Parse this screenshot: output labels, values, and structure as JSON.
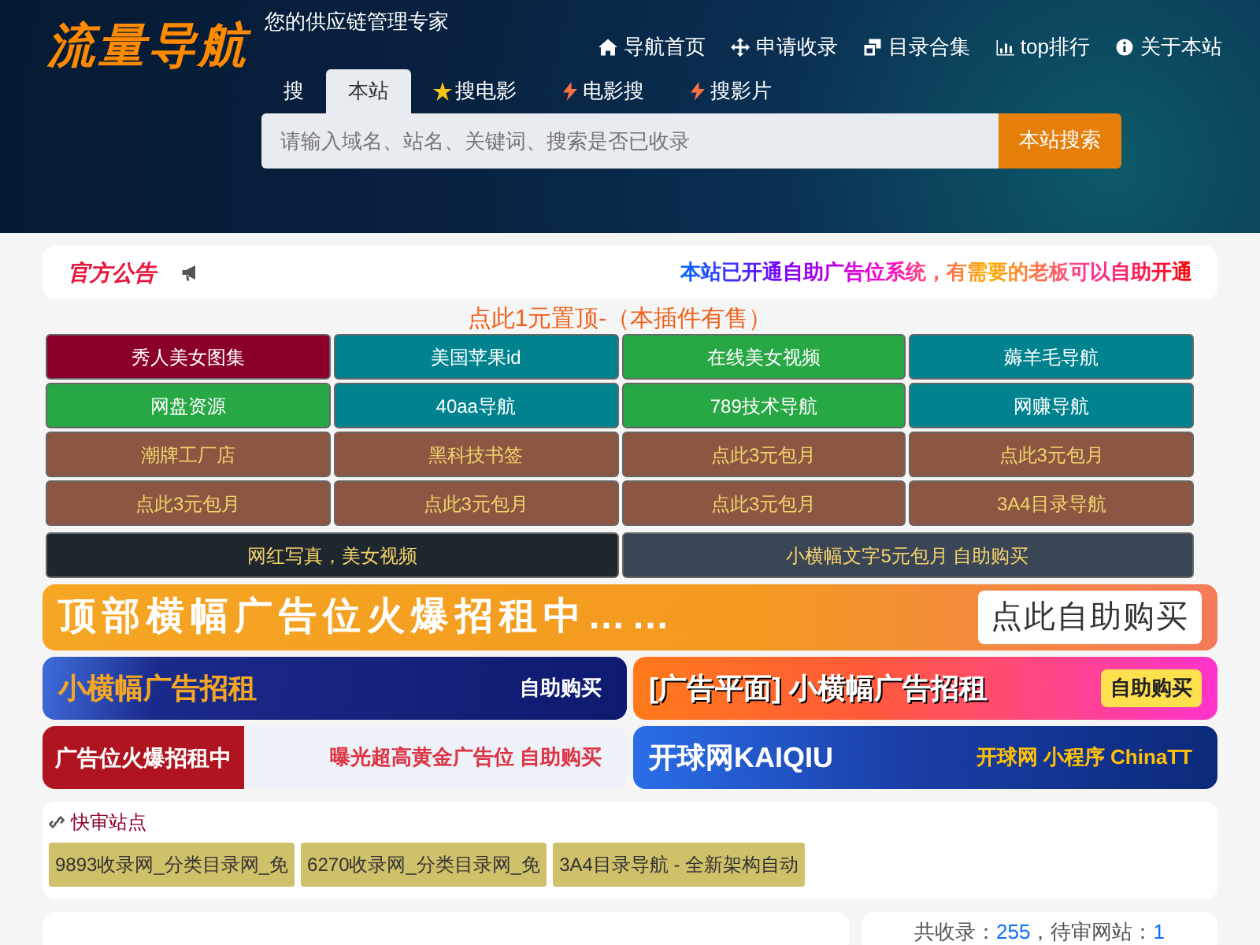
{
  "header": {
    "logo": "流量导航",
    "tagline": "您的供应链管理专家",
    "nav": [
      {
        "label": "导航首页"
      },
      {
        "label": "申请收录"
      },
      {
        "label": "目录合集"
      },
      {
        "label": "top排行"
      },
      {
        "label": "关于本站"
      }
    ]
  },
  "search": {
    "prefix": "搜",
    "tabs": [
      {
        "label": "本站",
        "selected": true
      },
      {
        "label": "搜电影",
        "selected": false
      },
      {
        "label": "电影搜",
        "selected": false
      },
      {
        "label": "搜影片",
        "selected": false
      }
    ],
    "placeholder": "请输入域名、站名、关键词、搜索是否已收录",
    "button": "本站搜索"
  },
  "notice": {
    "title": "官方公告",
    "text": "本站已开通自助广告位系统，有需要的老板可以自助开通"
  },
  "pin_title": "点此1元置顶-（本插件有售）",
  "links": [
    {
      "label": "秀人美女图集",
      "color": "#8b0028",
      "kind": "link"
    },
    {
      "label": "美国苹果id",
      "color": "#00838f",
      "kind": "link"
    },
    {
      "label": "在线美女视频",
      "color": "#28a745",
      "kind": "link"
    },
    {
      "label": "薅羊毛导航",
      "color": "#00838f",
      "kind": "link"
    },
    {
      "label": "网盘资源",
      "color": "#28a745",
      "kind": "link"
    },
    {
      "label": "40aa导航",
      "color": "#00838f",
      "kind": "link"
    },
    {
      "label": "789技术导航",
      "color": "#28a745",
      "kind": "link"
    },
    {
      "label": "网赚导航",
      "color": "#00838f",
      "kind": "link"
    },
    {
      "label": "潮牌工厂店",
      "color": "#8b5742",
      "kind": "promo"
    },
    {
      "label": "黑科技书签",
      "color": "#8b5742",
      "kind": "promo"
    },
    {
      "label": "点此3元包月",
      "color": "#8b5742",
      "kind": "promo"
    },
    {
      "label": "点此3元包月",
      "color": "#8b5742",
      "kind": "promo"
    },
    {
      "label": "点此3元包月",
      "color": "#8b5742",
      "kind": "promo"
    },
    {
      "label": "点此3元包月",
      "color": "#8b5742",
      "kind": "promo"
    },
    {
      "label": "点此3元包月",
      "color": "#8b5742",
      "kind": "promo"
    },
    {
      "label": "3A4目录导航",
      "color": "#8b5742",
      "kind": "promo"
    }
  ],
  "text_ads": [
    {
      "label": "网红写真，美女视频",
      "color": "#1e272e"
    },
    {
      "label": "小横幅文字5元包月 自助购买",
      "color": "#3a4556"
    }
  ],
  "banners": [
    {
      "kind": "wide",
      "text": "顶部横幅广告位火爆招租中……",
      "button": "点此自助购买"
    },
    {
      "kind": "blue",
      "text": "小横幅广告招租",
      "button": "自助购买"
    },
    {
      "kind": "pink",
      "text": "[广告平面] 小横幅广告招租",
      "button": "自助购买"
    },
    {
      "kind": "red",
      "text": "广告位火爆招租中",
      "button": "曝光超高黄金广告位 自助购买"
    },
    {
      "kind": "navy",
      "text": "开球网KAIQIU",
      "button": "开球网 小程序 ChinaTT"
    }
  ],
  "quick_sites": {
    "title": "快审站点",
    "items": [
      "9893收录网_分类目录网_免",
      "6270收录网_分类目录网_免",
      "3A4目录导航 - 全新架构自动"
    ]
  },
  "stats": {
    "total_label": "共收录：",
    "total": "255",
    "pending_label": "，待审网站：",
    "pending": "1"
  }
}
